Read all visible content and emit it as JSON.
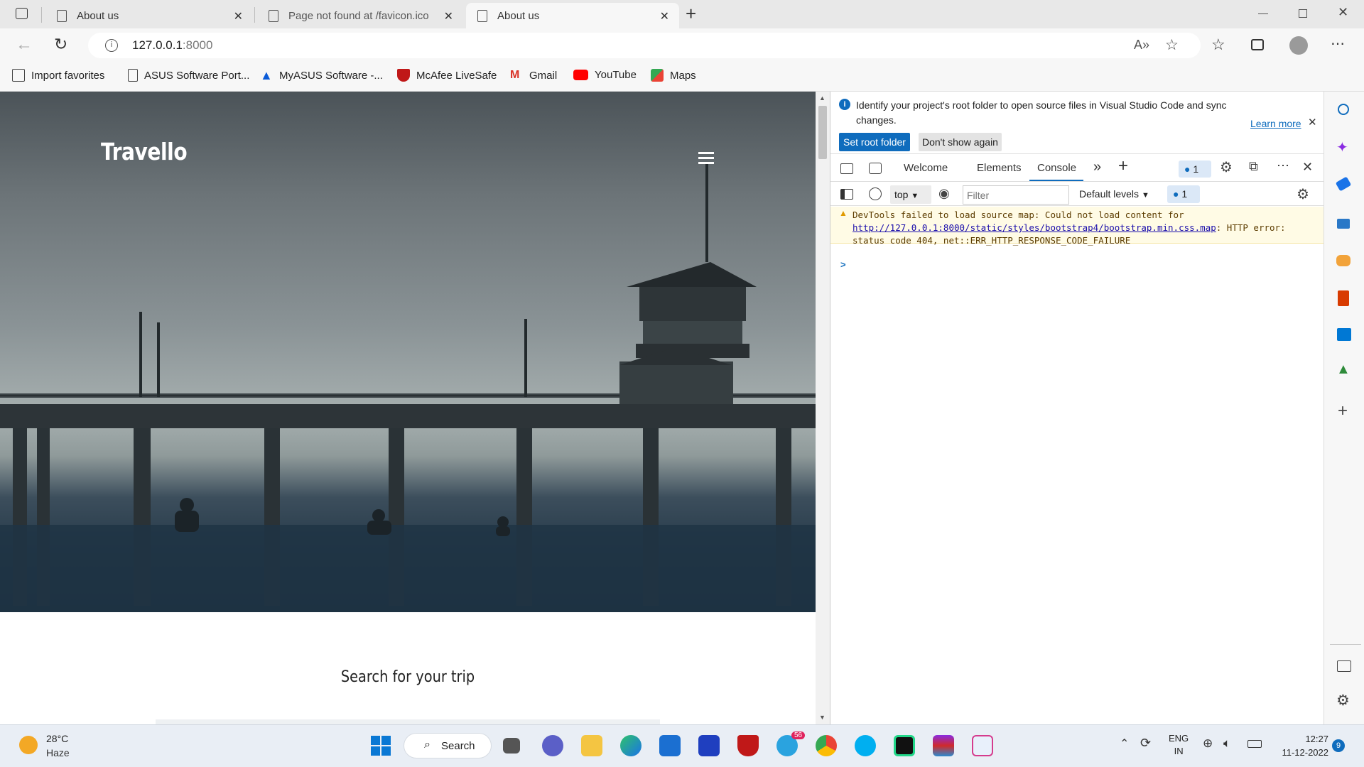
{
  "browser": {
    "tabs": [
      {
        "title": "About us"
      },
      {
        "title": "Page not found at /favicon.ico"
      },
      {
        "title": "About us"
      }
    ],
    "address": "127.0.0.1",
    "address_port": ":8000",
    "bookmarks": [
      {
        "label": "Import favorites",
        "icon": "import-icon"
      },
      {
        "label": "ASUS Software Port...",
        "icon": "page-icon"
      },
      {
        "label": "MyASUS Software -...",
        "icon": "myasus-icon"
      },
      {
        "label": "McAfee LiveSafe",
        "icon": "mcafee-icon"
      },
      {
        "label": "Gmail",
        "icon": "gmail-icon"
      },
      {
        "label": "YouTube",
        "icon": "youtube-icon"
      },
      {
        "label": "Maps",
        "icon": "maps-icon"
      }
    ]
  },
  "site": {
    "brand": "Travello",
    "search_heading": "Search for your trip"
  },
  "devtools": {
    "banner": {
      "message": "Identify your project's root folder to open source files in Visual Studio Code and sync changes.",
      "learn_more": "Learn more",
      "primary_button": "Set root folder",
      "secondary_button": "Don't show again"
    },
    "tabs": [
      "Welcome",
      "Elements",
      "Console"
    ],
    "active_tab": "Console",
    "issues_count": "1",
    "console_toolbar": {
      "context": "top",
      "filter_placeholder": "Filter",
      "levels": "Default levels",
      "issues_count": "1"
    },
    "warning": {
      "text_before": "DevTools failed to load source map: Could not load content for ",
      "link": "http://127.0.0.1:8000/static/styles/bootstrap4/bootstrap.min.css.map",
      "text_after": ": HTTP error: status code 404, net::ERR_HTTP_RESPONSE_CODE_FAILURE"
    },
    "prompt": ">"
  },
  "taskbar": {
    "weather_temp": "28°C",
    "weather_desc": "Haze",
    "search_label": "Search",
    "telegram_badge": "56",
    "lang": "ENG",
    "region": "IN",
    "time": "12:27",
    "date": "11-12-2022",
    "notification_count": "9"
  },
  "colors": {
    "accent": "#0f6cbd",
    "console_warning_bg": "#fffbe5",
    "link": "#1a0dab"
  }
}
